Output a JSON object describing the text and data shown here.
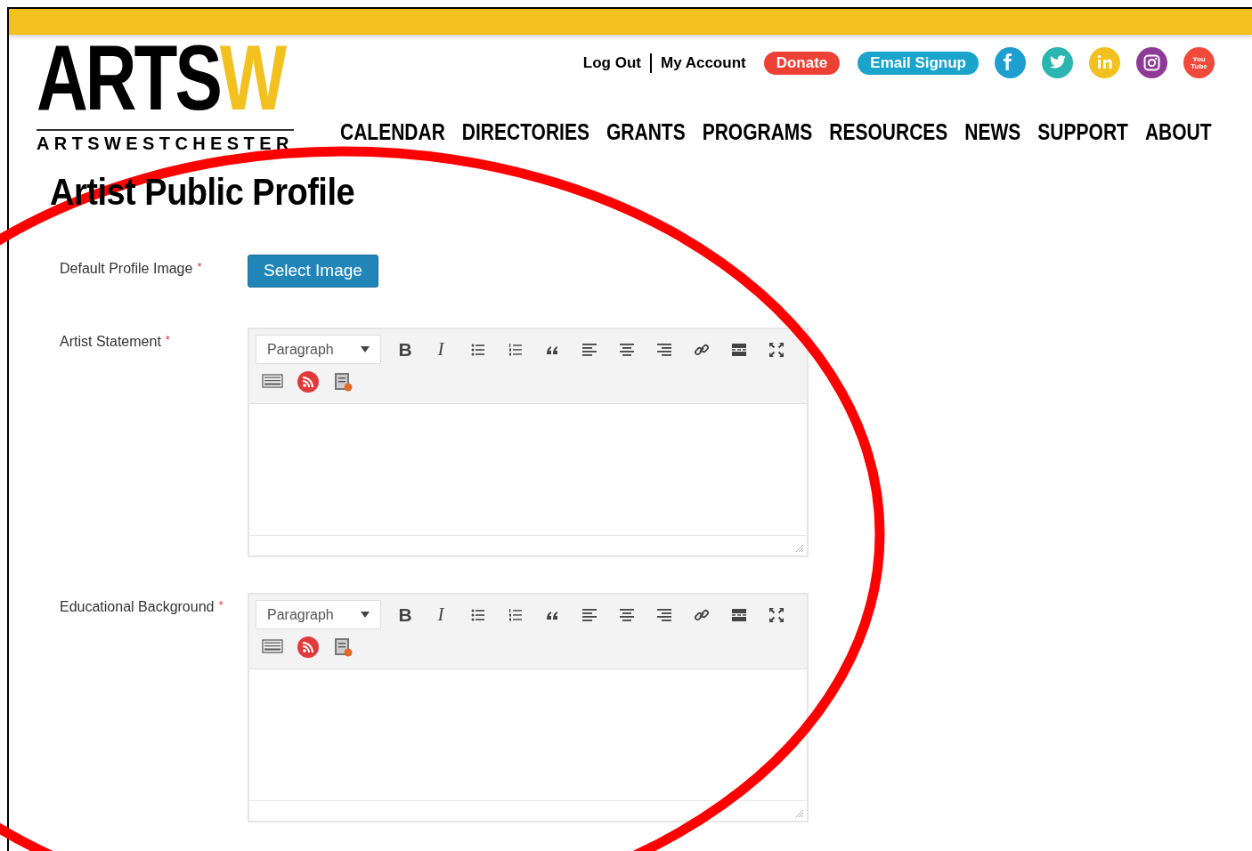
{
  "logo": {
    "main": "ARTS",
    "accent": "W",
    "subtitle": "ARTSWESTCHESTER"
  },
  "top_links": [
    "Log Out",
    "My Account"
  ],
  "top_buttons": [
    {
      "label": "Donate",
      "color": "#ee4136"
    },
    {
      "label": "Email Signup",
      "color": "#1ba4cb"
    }
  ],
  "social": [
    {
      "kind": "facebook",
      "color": "#1e9fd0"
    },
    {
      "kind": "twitter",
      "color": "#2bb5b0"
    },
    {
      "kind": "linkedin",
      "color": "#f2c01f"
    },
    {
      "kind": "instagram",
      "color": "#8e3a98"
    },
    {
      "kind": "youtube",
      "color": "#ef4a3c",
      "label": "You Tube"
    }
  ],
  "nav": [
    "CALENDAR",
    "DIRECTORIES",
    "GRANTS",
    "PROGRAMS",
    "RESOURCES",
    "NEWS",
    "SUPPORT",
    "ABOUT"
  ],
  "page_title": "Artist Public Profile",
  "fields": [
    {
      "kind": "image",
      "label": "Default Profile Image",
      "required": true,
      "required_mark": "*",
      "button": "Select Image"
    },
    {
      "kind": "editor",
      "label": "Artist Statement",
      "required": true,
      "required_mark": "*",
      "format": "Paragraph",
      "tools": [
        "B",
        "I"
      ]
    },
    {
      "kind": "editor",
      "label": "Educational Background",
      "required": true,
      "required_mark": "*",
      "format": "Paragraph",
      "tools": [
        "B",
        "I"
      ]
    }
  ]
}
